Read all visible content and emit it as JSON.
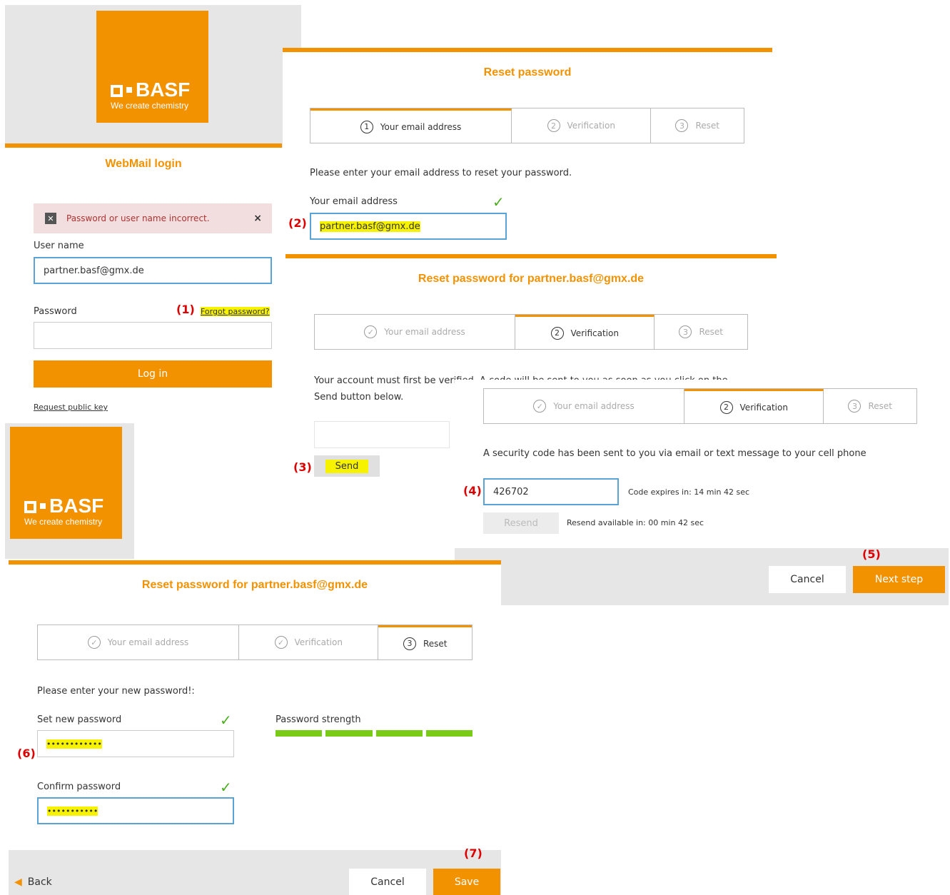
{
  "logo": {
    "brand": "BASF",
    "tagline": "We create chemistry"
  },
  "login": {
    "title": "WebMail login",
    "error": "Password or user name incorrect.",
    "error_close": "×",
    "username_label": "User name",
    "username_value": "partner.basf@gmx.de",
    "password_label": "Password",
    "forgot": "Forgot password?",
    "login_button": "Log in",
    "public_key": "Request public key"
  },
  "step_labels": {
    "s1": "Your email address",
    "s2": "Verification",
    "s3": "Reset"
  },
  "step_numbers": {
    "n1": "1",
    "n2": "2",
    "n3": "3"
  },
  "check_glyph": "✓",
  "annotations": {
    "a1": "(1)",
    "a2": "(2)",
    "a3": "(3)",
    "a4": "(4)",
    "a5": "(5)",
    "a6": "(6)",
    "a7": "(7)"
  },
  "reset1": {
    "title": "Reset password",
    "instruction": "Please enter your email address to reset your password.",
    "email_label": "Your email address",
    "email_value": "partner.basf@gmx.de"
  },
  "reset2": {
    "title": "Reset password for partner.basf@gmx.de",
    "instruction": "Your account must first be verified. A code will be sent to you as soon as you click on the Send button below.",
    "send_button": "Send"
  },
  "reset3": {
    "message": "A security code has been sent to you via email or text message to your cell phone",
    "code_value": "426702",
    "expires": "Code expires in: 14 min 42 sec",
    "resend_button": "Resend",
    "resend_info": "Resend available in: 00 min 42 sec",
    "cancel": "Cancel",
    "next": "Next step"
  },
  "reset4": {
    "title": "Reset password for partner.basf@gmx.de",
    "instruction": "Please enter your new password!:",
    "new_label": "Set new password",
    "new_value": "••••••••••••",
    "confirm_label": "Confirm password",
    "confirm_value": "•••••••••••",
    "strength_label": "Password strength",
    "strength_segments_filled": 4,
    "strength_color": "#7acb18",
    "back": "Back",
    "cancel": "Cancel",
    "save": "Save"
  },
  "colors": {
    "accent": "#f39200",
    "highlight": "#f7f200",
    "annotation": "#dd0000",
    "check": "#4cae20"
  }
}
